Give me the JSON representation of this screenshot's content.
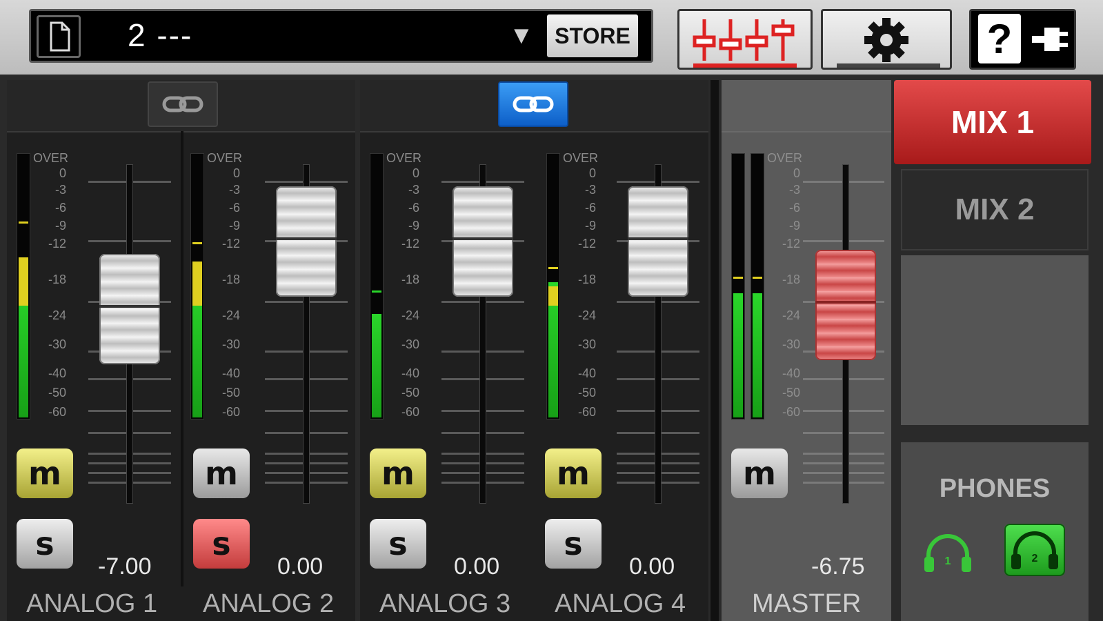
{
  "header": {
    "preset_name": "2 ---",
    "dropdown_arrow": "▼",
    "store_label": "STORE",
    "help_label": "?"
  },
  "scale_labels": [
    "OVER",
    "0",
    "-3",
    "-6",
    "-9",
    "-12",
    "-18",
    "-24",
    "-30",
    "-40",
    "-50",
    "-60"
  ],
  "channels": [
    {
      "label": "ANALOG 1",
      "value": "-7.00",
      "mute": "m",
      "solo": "s",
      "mute_active": true,
      "solo_active": false
    },
    {
      "label": "ANALOG 2",
      "value": "0.00",
      "mute": "m",
      "solo": "s",
      "mute_active": false,
      "solo_active": true
    },
    {
      "label": "ANALOG 3",
      "value": "0.00",
      "mute": "m",
      "solo": "s",
      "mute_active": true,
      "solo_active": false
    },
    {
      "label": "ANALOG 4",
      "value": "0.00",
      "mute": "m",
      "solo": "s",
      "mute_active": true,
      "solo_active": false
    }
  ],
  "master": {
    "label": "MASTER",
    "value": "-6.75",
    "mute": "m"
  },
  "mixes": {
    "mix1": "MIX 1",
    "mix2": "MIX 2"
  },
  "phones": {
    "title": "PHONES",
    "phone1_number": "1",
    "phone2_number": "2"
  },
  "colors": {
    "accent_red": "#c72a2a",
    "meter_green": "#2ad62a",
    "link_active_blue": "#1f7fe0",
    "mute_active_yellow": "#d6d25a",
    "phones_active_green": "#2bbf2b"
  }
}
